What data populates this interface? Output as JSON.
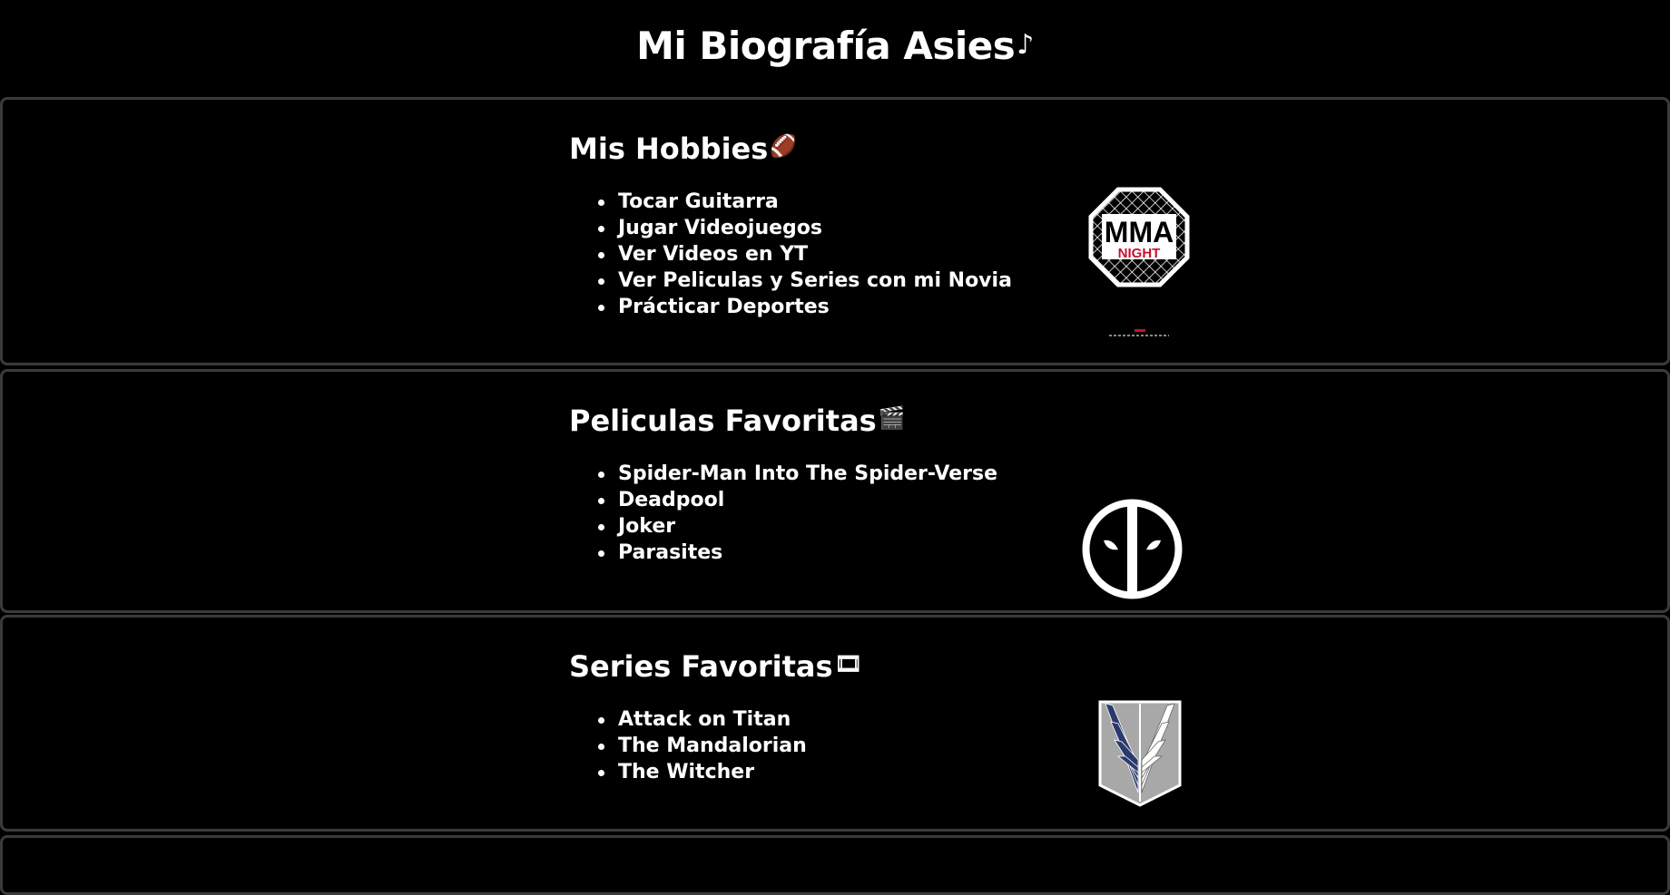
{
  "page": {
    "title": "Mi Biografía Asies",
    "title_icon": "♪"
  },
  "hobbies": {
    "title": "Mis Hobbies",
    "icon": "🏈",
    "items": [
      "Tocar Guitarra",
      "Jugar Videojuegos",
      "Ver Videos en YT",
      "Ver Peliculas y Series con mi Novia",
      "Prácticar Deportes"
    ],
    "image": {
      "name": "mma-night-logo",
      "text_top": "MMA",
      "text_bottom": "NIGHT",
      "accent": "#c8102e"
    }
  },
  "movies": {
    "title": "Peliculas Favoritas",
    "icon": "🎬",
    "items": [
      "Spider-Man Into The Spider-Verse",
      "Deadpool",
      "Joker",
      "Parasites"
    ],
    "image": {
      "name": "deadpool-logo"
    }
  },
  "series": {
    "title": "Series Favoritas",
    "icon": "🎞",
    "items": [
      "Attack on Titan",
      "The Mandalorian",
      "The Witcher"
    ],
    "image": {
      "name": "survey-corps-emblem",
      "wing_left": "#2b3a6b",
      "wing_right": "#ffffff",
      "shield": "#a8a8a8"
    }
  },
  "colors": {
    "background": "#000000",
    "text": "#ffffff",
    "border": "#3a3a3a"
  }
}
